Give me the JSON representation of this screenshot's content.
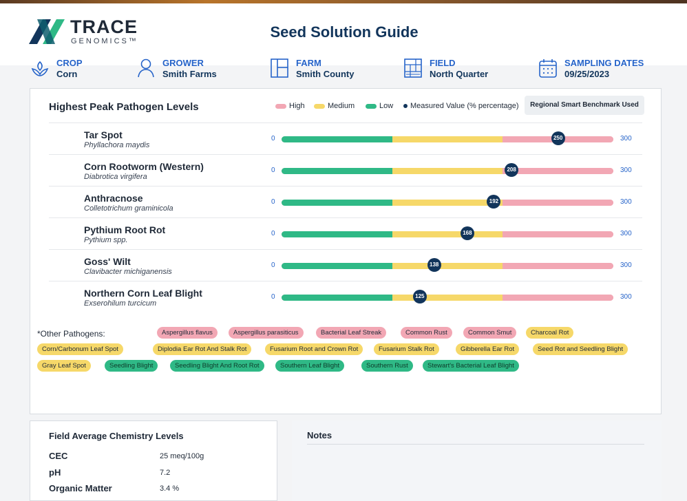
{
  "brand": {
    "name_line1": "TRACE",
    "name_line2": "GENOMICS™"
  },
  "title": "Seed Solution Guide",
  "meta": [
    {
      "label": "CROP",
      "value": "Corn",
      "icon": "sprout-icon"
    },
    {
      "label": "GROWER",
      "value": "Smith Farms",
      "icon": "user-icon"
    },
    {
      "label": "FARM",
      "value": "Smith County",
      "icon": "farm-plot-icon"
    },
    {
      "label": "FIELD",
      "value": "North Quarter",
      "icon": "field-map-icon"
    },
    {
      "label": "SAMPLING DATES",
      "value": "09/25/2023",
      "icon": "calendar-icon"
    }
  ],
  "pathogens": {
    "title": "Highest Peak Pathogen Levels",
    "legend": {
      "high": "High",
      "medium": "Medium",
      "low": "Low",
      "measured": "Measured Value (% percentage)"
    },
    "benchmark": "Regional Smart Benchmark Used",
    "colors": {
      "high": "#f2a7b4",
      "medium": "#f6d869",
      "low": "#2fb986",
      "marker": "#12355b"
    },
    "range": {
      "min": 0,
      "max": 300,
      "min_label": "0",
      "max_label": "300"
    },
    "thresholds": {
      "low_end": 100,
      "medium_end": 200
    },
    "items": [
      {
        "name": "Tar Spot",
        "scientific": "Phyllachora maydis",
        "value": 250,
        "value_label": "250"
      },
      {
        "name": "Corn Rootworm (Western)",
        "scientific": "Diabrotica virgifera",
        "value": 208,
        "value_label": "208"
      },
      {
        "name": "Anthracnose",
        "scientific": "Colletotrichum graminicola",
        "value": 192,
        "value_label": "192"
      },
      {
        "name": "Pythium Root Rot",
        "scientific": "Pythium spp.",
        "value": 168,
        "value_label": "168"
      },
      {
        "name": "Goss' Wilt",
        "scientific": "Clavibacter michiganensis",
        "value": 138,
        "value_label": "138"
      },
      {
        "name": "Northern Corn Leaf Blight",
        "scientific": "Exserohilum turcicum",
        "value": 125,
        "value_label": "125"
      }
    ]
  },
  "other_pathogens": {
    "label": "*Other Pathogens:",
    "items": [
      {
        "name": "Aspergillus flavus",
        "level": "high"
      },
      {
        "name": "Aspergillus parasiticus",
        "level": "high"
      },
      {
        "name": "Bacterial Leaf Streak",
        "level": "high"
      },
      {
        "name": "Common Rust",
        "level": "high"
      },
      {
        "name": "Common Smut",
        "level": "high"
      },
      {
        "name": "Charcoal Rot",
        "level": "medium"
      },
      {
        "name": "Corn/Carbonum Leaf Spot",
        "level": "medium"
      },
      {
        "name": "Diplodia Ear Rot And Stalk Rot",
        "level": "medium"
      },
      {
        "name": "Fusarium Root and Crown Rot",
        "level": "medium"
      },
      {
        "name": "Fusarium Stalk Rot",
        "level": "medium"
      },
      {
        "name": "Gibberella Ear Rot",
        "level": "medium"
      },
      {
        "name": "Seed Rot and Seedling Blight",
        "level": "medium"
      },
      {
        "name": "Gray Leaf Spot",
        "level": "medium"
      },
      {
        "name": "Seedling Blight",
        "level": "low"
      },
      {
        "name": "Seedling Blight And Root Rot",
        "level": "low"
      },
      {
        "name": "Southern Leaf Blight",
        "level": "low"
      },
      {
        "name": "Southern Rust",
        "level": "low"
      },
      {
        "name": "Stewart's Bacterial Leaf Blight",
        "level": "low"
      }
    ]
  },
  "chemistry": {
    "title": "Field Average Chemistry Levels",
    "rows": [
      {
        "label": "CEC",
        "value": "25 meq/100g"
      },
      {
        "label": "pH",
        "value": "7.2"
      },
      {
        "label": "Organic Matter",
        "value": "3.4 %"
      }
    ]
  },
  "notes": {
    "title": "Notes",
    "text": ""
  }
}
